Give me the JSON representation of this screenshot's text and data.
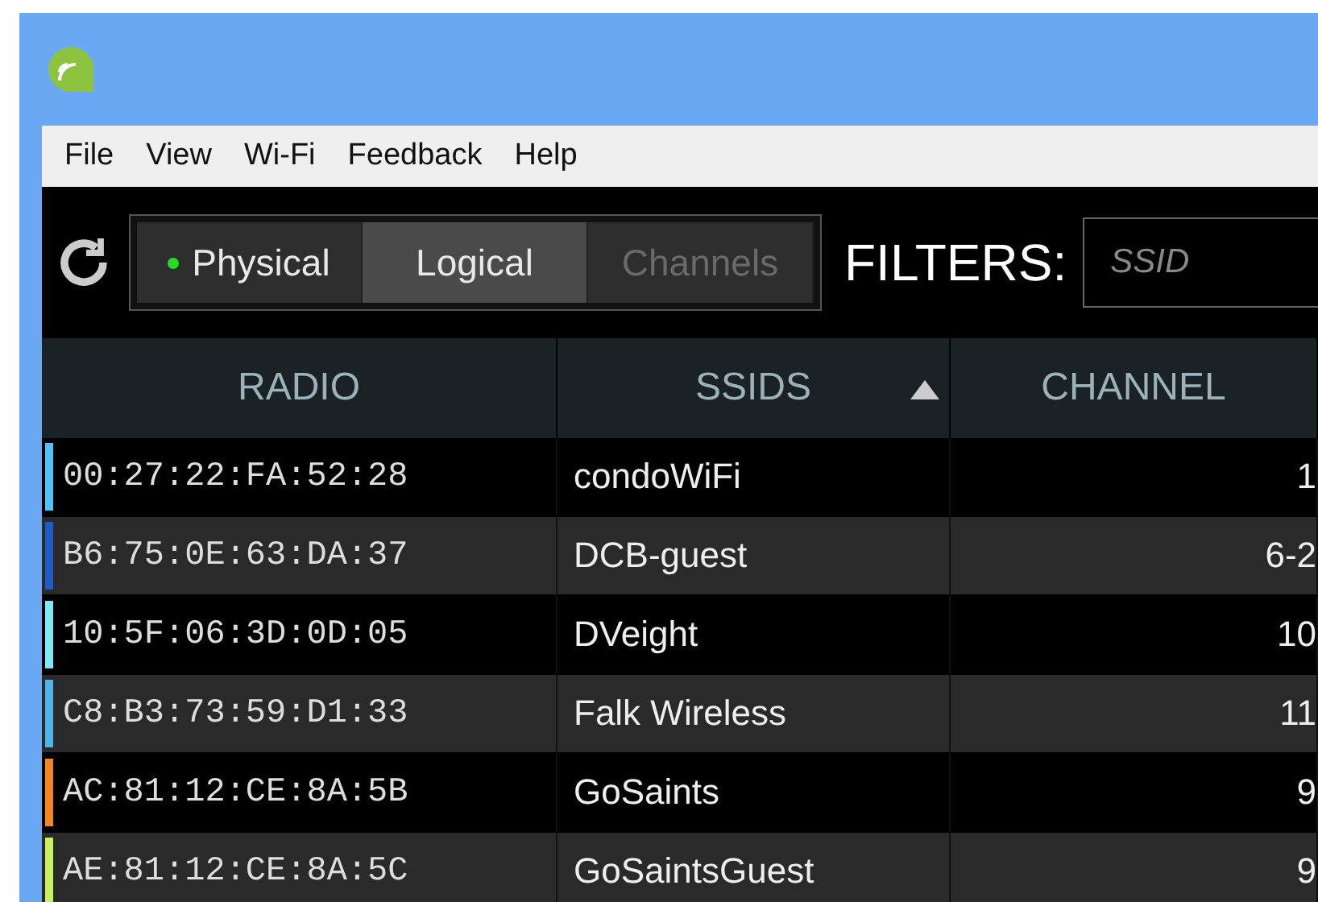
{
  "menu": [
    "File",
    "View",
    "Wi-Fi",
    "Feedback",
    "Help"
  ],
  "view_tabs": [
    {
      "label": "Physical",
      "selected": false,
      "live": true,
      "disabled": false
    },
    {
      "label": "Logical",
      "selected": true,
      "live": false,
      "disabled": false
    },
    {
      "label": "Channels",
      "selected": false,
      "live": false,
      "disabled": true
    }
  ],
  "filters": {
    "label": "FILTERS:",
    "placeholder": "SSID"
  },
  "table": {
    "columns": [
      {
        "label": "RADIO",
        "sorted": false
      },
      {
        "label": "SSIDS",
        "sorted": true
      },
      {
        "label": "CHANNEL",
        "sorted": false
      }
    ],
    "rows": [
      {
        "radio": "00:27:22:FA:52:28",
        "ssid": "condoWiFi",
        "channel": "1",
        "color": "#4fc3f7"
      },
      {
        "radio": "B6:75:0E:63:DA:37",
        "ssid": "DCB-guest",
        "channel": "6-2",
        "color": "#1e5bc6"
      },
      {
        "radio": "10:5F:06:3D:0D:05",
        "ssid": "DVeight",
        "channel": "10",
        "color": "#7fe8f8"
      },
      {
        "radio": "C8:B3:73:59:D1:33",
        "ssid": "Falk Wireless",
        "channel": "11",
        "color": "#4db6e8"
      },
      {
        "radio": "AC:81:12:CE:8A:5B",
        "ssid": "GoSaints",
        "channel": "9",
        "color": "#f5861f"
      },
      {
        "radio": "AE:81:12:CE:8A:5C",
        "ssid": "GoSaintsGuest",
        "channel": "9",
        "color": "#c8f060"
      }
    ]
  }
}
